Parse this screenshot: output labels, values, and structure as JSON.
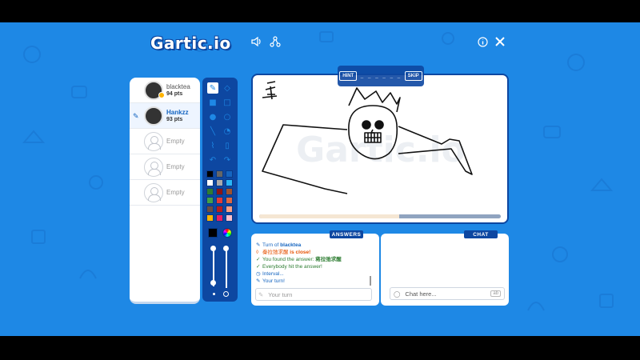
{
  "app": {
    "logo": "Gartic.io"
  },
  "topbar": {
    "sound_icon": "speaker-icon",
    "share_icon": "share-icon",
    "info_icon": "info-icon",
    "close_icon": "close-icon"
  },
  "players": [
    {
      "name": "blacktea",
      "points": "94 pts"
    },
    {
      "name": "Hankzz",
      "points": "93 pts"
    },
    {
      "name": "Empty"
    },
    {
      "name": "Empty"
    },
    {
      "name": "Empty"
    }
  ],
  "hint": {
    "hint_label": "HINT",
    "word_pattern": "_ _ _ _ _ _",
    "skip_label": "SKIP"
  },
  "canvas": {
    "watermark": "Gartic.io",
    "progress": 0.58
  },
  "answers": {
    "title": "ANSWERS",
    "messages": [
      {
        "icon": "✎",
        "text": "Turn of ",
        "bold": "blacktea",
        "color": "#1565c0"
      },
      {
        "icon": "◊",
        "text": "秦拉弛求醒",
        "bold": " is close!",
        "color": "#e65100"
      },
      {
        "icon": "✓",
        "text": "You found the answer: ",
        "bold": "蒋拉弛求醒",
        "color": "#2e7d32"
      },
      {
        "icon": "✓",
        "text": "Everybody hit the answer!",
        "bold": "",
        "color": "#2e7d32"
      },
      {
        "icon": "◷",
        "text": "Interval...",
        "bold": "",
        "color": "#1565c0"
      },
      {
        "icon": "✎",
        "text": "Your turn!",
        "bold": "",
        "color": "#1565c0"
      }
    ],
    "input_placeholder": "Your turn"
  },
  "chat": {
    "title": "CHAT",
    "input_placeholder": "Chat here...",
    "badge": "ab"
  },
  "palette": [
    "#000000",
    "#666666",
    "#1565c0",
    "#ffffff",
    "#aaaaaa",
    "#29b6f6",
    "#2e7d32",
    "#8d1414",
    "#a0522d",
    "#43a047",
    "#e53935",
    "#e0663f",
    "#6d4c41",
    "#b71c1c",
    "#ff9e80",
    "#ffb300",
    "#e91e63",
    "#ffc0cb"
  ],
  "current_color": "#000000"
}
